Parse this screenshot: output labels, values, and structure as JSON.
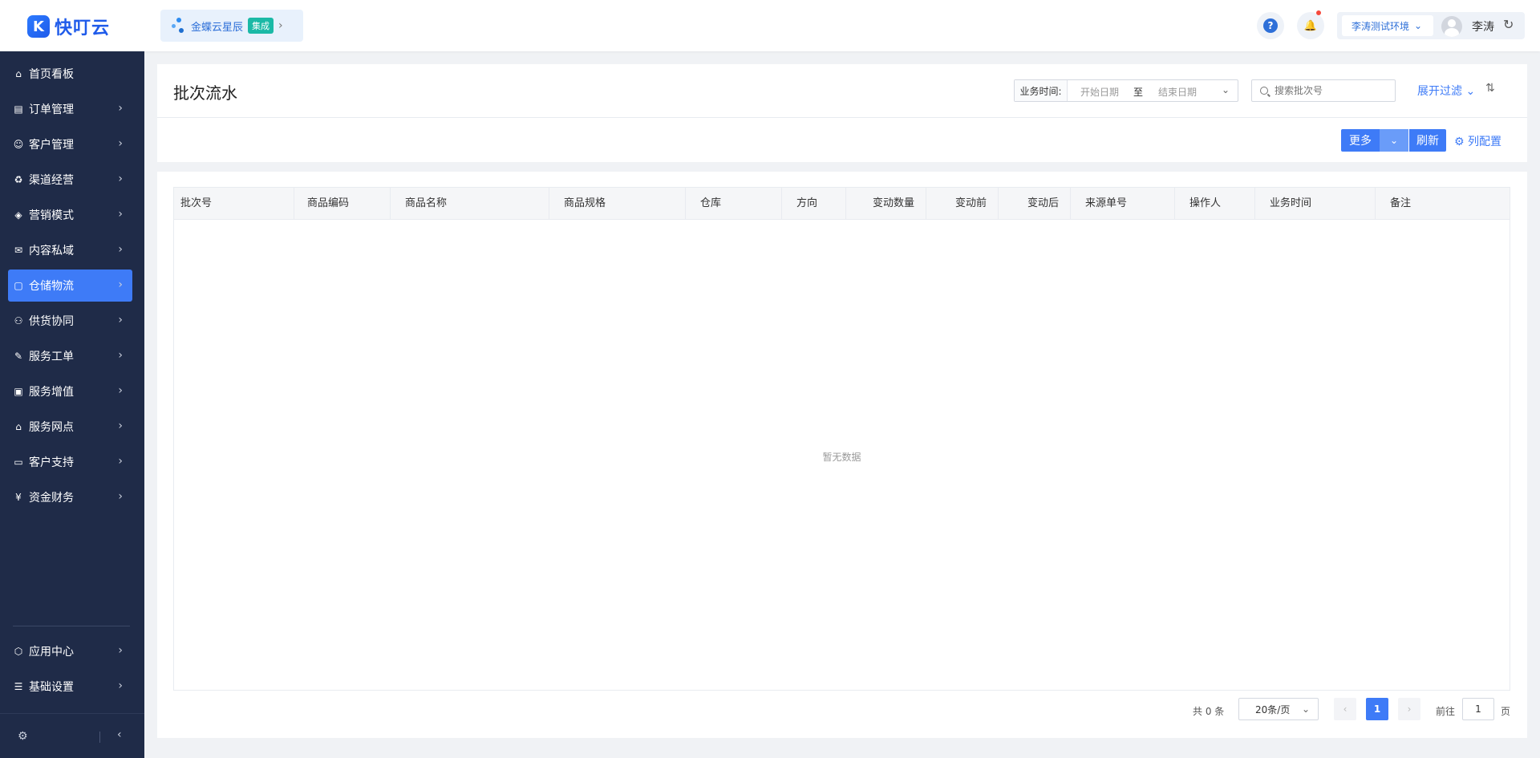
{
  "header": {
    "logo_mark": "K",
    "logo_text": "快叮云",
    "integration": {
      "name": "金蝶云星辰",
      "tag": "集成",
      "chevron": "›"
    },
    "help_glyph": "?",
    "bell_glyph": "🔔",
    "env": "李涛测试环境",
    "env_chevron": "⌄",
    "username": "李涛",
    "refresh_glyph": "↻"
  },
  "sidebar": {
    "items": [
      {
        "label": "首页看板",
        "icon": "⌂",
        "icon_name": "home-icon",
        "has_arrow": false,
        "active": false
      },
      {
        "label": "订单管理",
        "icon": "▤",
        "icon_name": "order-icon",
        "has_arrow": true,
        "active": false
      },
      {
        "label": "客户管理",
        "icon": "☺",
        "icon_name": "customer-icon",
        "has_arrow": true,
        "active": false
      },
      {
        "label": "渠道经营",
        "icon": "♻",
        "icon_name": "channel-icon",
        "has_arrow": true,
        "active": false
      },
      {
        "label": "营销模式",
        "icon": "◈",
        "icon_name": "tag-icon",
        "has_arrow": true,
        "active": false
      },
      {
        "label": "内容私域",
        "icon": "✉",
        "icon_name": "content-icon",
        "has_arrow": true,
        "active": false
      },
      {
        "label": "仓储物流",
        "icon": "▢",
        "icon_name": "warehouse-icon",
        "has_arrow": true,
        "active": true
      },
      {
        "label": "供货协同",
        "icon": "⚇",
        "icon_name": "supply-icon",
        "has_arrow": true,
        "active": false
      },
      {
        "label": "服务工单",
        "icon": "✎",
        "icon_name": "ticket-icon",
        "has_arrow": true,
        "active": false
      },
      {
        "label": "服务增值",
        "icon": "▣",
        "icon_name": "bag-icon",
        "has_arrow": true,
        "active": false
      },
      {
        "label": "服务网点",
        "icon": "⌂",
        "icon_name": "store-icon",
        "has_arrow": true,
        "active": false
      },
      {
        "label": "客户支持",
        "icon": "▭",
        "icon_name": "support-icon",
        "has_arrow": true,
        "active": false
      },
      {
        "label": "资金财务",
        "icon": "¥",
        "icon_name": "finance-icon",
        "has_arrow": true,
        "active": false
      }
    ],
    "bottom_items": [
      {
        "label": "应用中心",
        "icon": "⬡",
        "icon_name": "app-center-icon"
      },
      {
        "label": "基础设置",
        "icon": "☰",
        "icon_name": "settings-list-icon"
      }
    ],
    "arrow": "›",
    "gear": "⚙",
    "collapse": "‹"
  },
  "page": {
    "title": "批次流水",
    "filter": {
      "date_label": "业务时间:",
      "start_placeholder": "开始日期",
      "separator": "至",
      "end_placeholder": "结束日期",
      "dropdown": "⌄",
      "search_placeholder": "搜索批次号",
      "expand_filter": "展开过滤 ⌄",
      "sort_glyph": "⇅"
    },
    "actions": {
      "more": "更多",
      "more_dropdown": "⌄",
      "refresh": "刷新",
      "column_config": "⚙ 列配置"
    },
    "table": {
      "columns": [
        "批次号",
        "商品编码",
        "商品名称",
        "商品规格",
        "仓库",
        "方向",
        "变动数量",
        "变动前",
        "变动后",
        "来源单号",
        "操作人",
        "业务时间",
        "备注"
      ],
      "empty_text": "暂无数据"
    },
    "pagination": {
      "total": "共 0 条",
      "page_size": "20条/页",
      "page_size_dropdown": "⌄",
      "prev": "‹",
      "current": "1",
      "next": "›",
      "goto_label": "前往",
      "goto_value": "1",
      "goto_suffix": "页"
    }
  },
  "colors": {
    "primary": "#3e7bf7",
    "sidebar_bg": "#1f2b48",
    "page_bg": "#f0f2f5"
  }
}
